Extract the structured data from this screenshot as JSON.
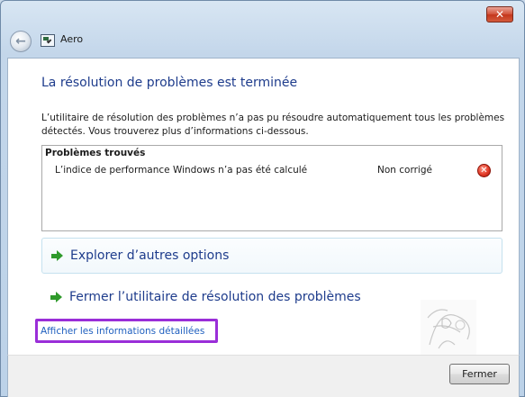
{
  "window": {
    "title": "Aero",
    "close_glyph": "✕"
  },
  "main": {
    "heading": "La résolution de problèmes est terminée",
    "description": "L’utilitaire de résolution des problèmes n’a pas pu résoudre automatiquement tous les problèmes détectés. Vous trouverez plus d’informations ci-dessous.",
    "problems": {
      "title": "Problèmes trouvés",
      "items": [
        {
          "name": "L’indice de performance Windows n’a pas été calculé",
          "status": "Non corrigé",
          "status_icon": "error-icon"
        }
      ]
    },
    "options": [
      {
        "label": "Explorer d’autres options",
        "icon": "green-arrow-icon"
      },
      {
        "label": "Fermer l’utilitaire de résolution des problèmes",
        "icon": "green-arrow-icon"
      }
    ],
    "details_link": "Afficher les informations détaillées"
  },
  "footer": {
    "close_button": "Fermer"
  },
  "colors": {
    "heading": "#1e3c8c",
    "link": "#1f5fbf",
    "highlight": "#9a2ed8",
    "arrow": "#2f9a2b",
    "error": "#e23b28"
  }
}
